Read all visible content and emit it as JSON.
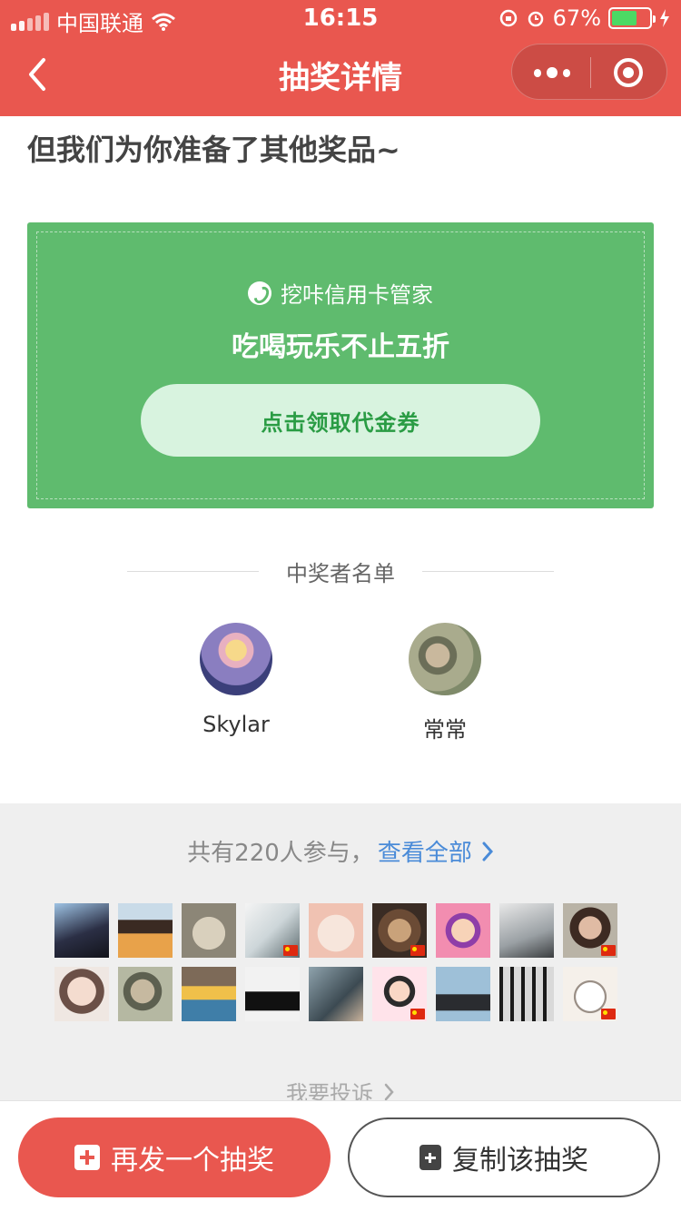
{
  "status_bar": {
    "carrier": "中国联通",
    "time": "16:15",
    "battery_percent": "67%",
    "battery_level": 0.67,
    "icons": [
      "signal-icon",
      "wifi-icon",
      "rotation-lock-icon",
      "alarm-icon",
      "battery-icon",
      "charging-icon"
    ]
  },
  "nav": {
    "title": "抽奖详情",
    "back_icon": "chevron-left-icon",
    "more_icon": "more-dots-icon",
    "close_icon": "target-circle-icon"
  },
  "subheading": "但我们为你准备了其他奖品~",
  "promo": {
    "brand": "挖咔信用卡管家",
    "title": "吃喝玩乐不止五折",
    "button_label": "点击领取代金券"
  },
  "winners": {
    "heading": "中奖者名单",
    "items": [
      {
        "name": "Skylar"
      },
      {
        "name": "常常"
      }
    ]
  },
  "participants": {
    "count_text": "共有220人参与，",
    "view_all_label": "查看全部",
    "report_label": "我要投诉"
  },
  "footer": {
    "primary_label": "再发一个抽奖",
    "secondary_label": "复制该抽奖"
  },
  "colors": {
    "brand_red": "#e9574f",
    "promo_green": "#5fbb6e",
    "link_blue": "#4a8bd8"
  }
}
